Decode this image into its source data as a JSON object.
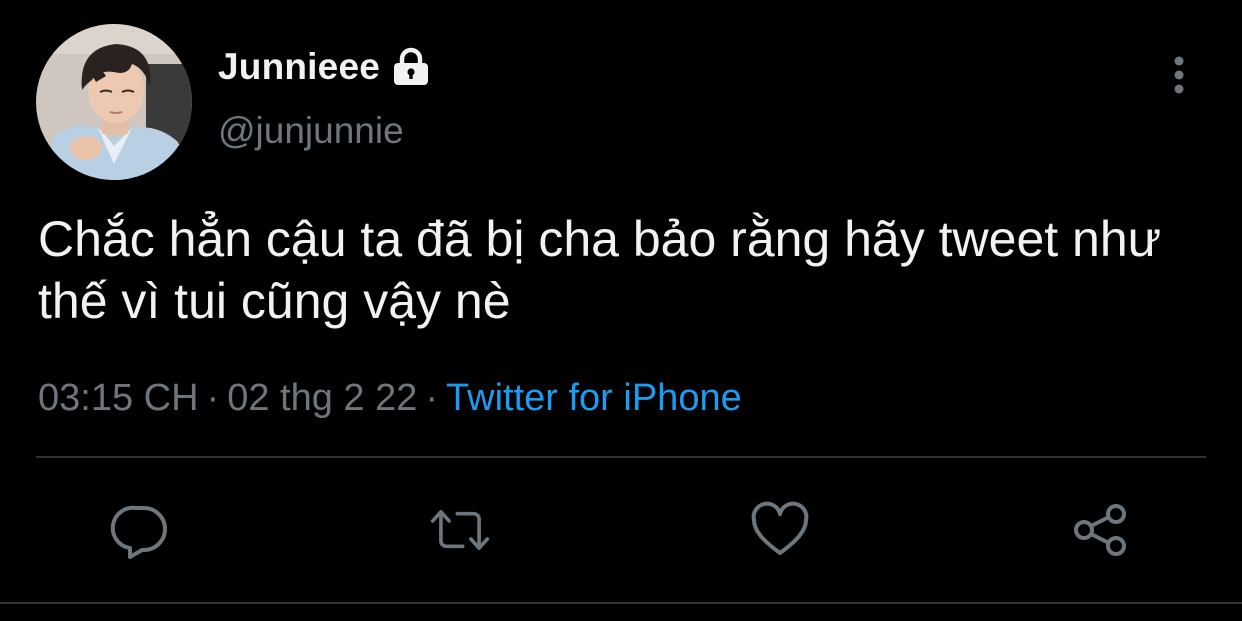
{
  "tweet": {
    "author": {
      "display_name": "Junnieee",
      "handle": "@junjunnie",
      "protected": true
    },
    "text": "Chắc hẳn cậu ta đã bị cha bảo rằng hãy tweet như thế vì tui cũng vậy nè",
    "time": "03:15 CH",
    "date": "02 thg 2 22",
    "separator": "·",
    "source": "Twitter for iPhone"
  },
  "actions": [
    {
      "icon": "reply-icon"
    },
    {
      "icon": "retweet-icon"
    },
    {
      "icon": "like-icon"
    },
    {
      "icon": "share-icon"
    }
  ],
  "colors": {
    "background": "#000000",
    "text_primary": "#f2f2f2",
    "text_secondary": "#6e767d",
    "link": "#1d9bf0",
    "divider": "#2f3336"
  }
}
